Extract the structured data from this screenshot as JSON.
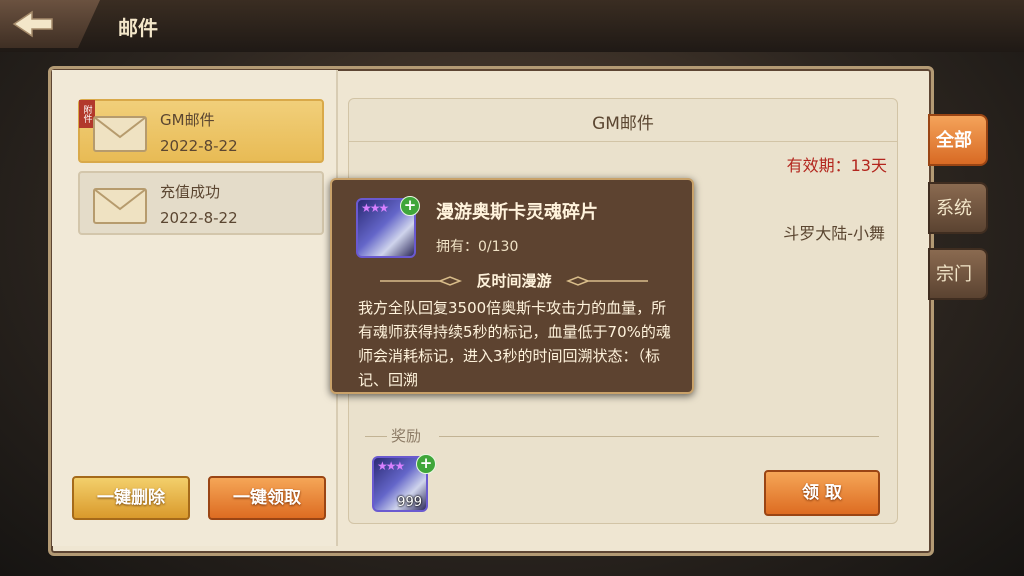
{
  "header": {
    "title": "邮件",
    "back_icon": "back-arrow-icon"
  },
  "mail_list": [
    {
      "title": "GM邮件",
      "date": "2022-8-22",
      "tag": "附件",
      "selected": true
    },
    {
      "title": "充值成功",
      "date": "2022-8-22",
      "tag": "",
      "selected": false
    }
  ],
  "buttons": {
    "delete_all": "一键删除",
    "claim_all": "一键领取",
    "claim": "领 取"
  },
  "detail": {
    "title": "GM邮件",
    "validity": "有效期：13天",
    "sender": "斗罗大陆-小舞",
    "reward_label": "奖励",
    "reward_count": "999"
  },
  "tabs": [
    {
      "label": "全部",
      "active": true
    },
    {
      "label": "系统",
      "active": false
    },
    {
      "label": "宗门",
      "active": false
    }
  ],
  "tooltip": {
    "name": "漫游奥斯卡灵魂碎片",
    "owned": "拥有：0/130",
    "skill_name": "反时间漫游",
    "description": "我方全队回复3500倍奥斯卡攻击力的血量，所有魂师获得持续5秒的标记，血量低于70%的魂师会消耗标记，进入3秒的时间回溯状态：（标记、回溯"
  },
  "colors": {
    "accent_orange": "#dd6c22",
    "validity_red": "#b3261e",
    "panel_bg": "#efe6d2",
    "tooltip_bg": "#5d4330"
  }
}
